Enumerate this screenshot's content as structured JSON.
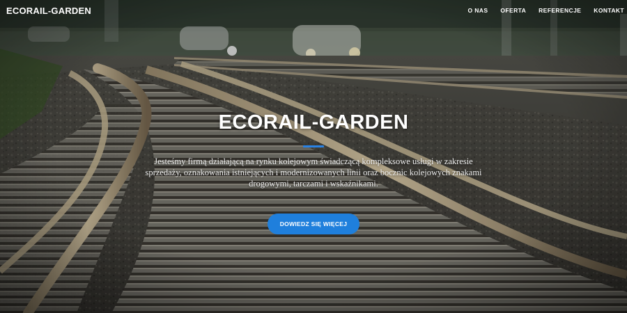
{
  "navbar": {
    "brand": "ECORAIL-GARDEN",
    "links": [
      "O NAS",
      "OFERTA",
      "REFERENCJE",
      "KONTAKT"
    ]
  },
  "hero": {
    "title": "ECORAIL-GARDEN",
    "subtitle": "Jesteśmy firmą działającą na rynku kolejowym świadczącą kompleksowe usługi w zakresie sprzedaży, oznakowania istniejących i modernizowanych linii oraz bocznic kolejowych znakami drogowymi, tarczami i wskaźnikami.",
    "cta_label": "DOWIEDZ SIĘ WIĘCEJ"
  },
  "colors": {
    "accent": "#1f7fdc",
    "nav_text": "#ffffff"
  }
}
